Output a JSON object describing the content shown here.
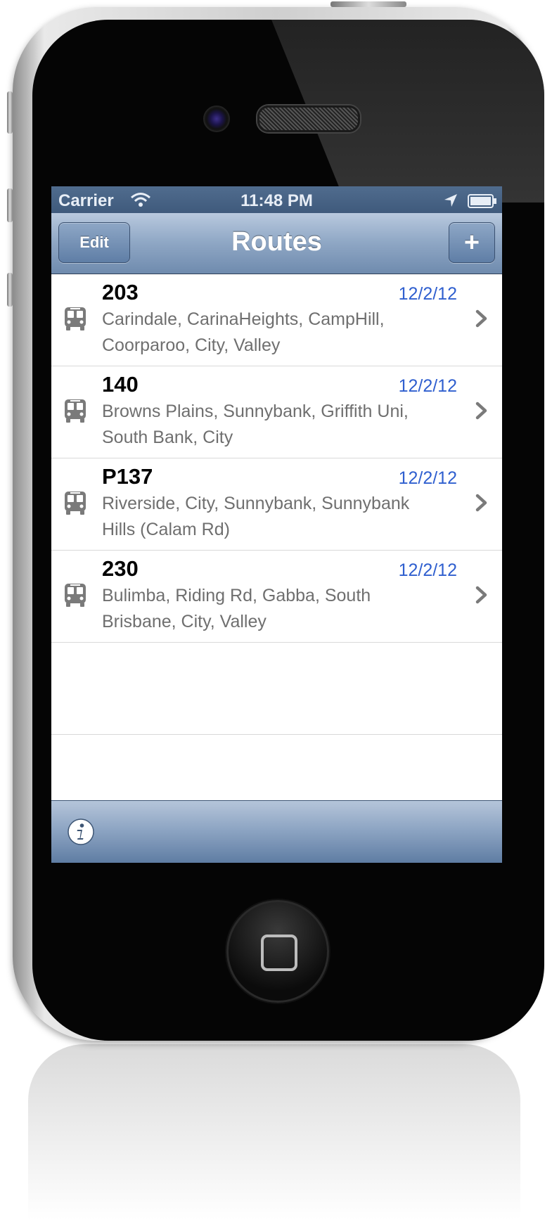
{
  "status_bar": {
    "carrier": "Carrier",
    "time": "11:48 PM"
  },
  "nav": {
    "title": "Routes",
    "edit_label": "Edit",
    "add_label": "+"
  },
  "routes": [
    {
      "number": "203",
      "date": "12/2/12",
      "stops": "Carindale, CarinaHeights, CampHill, Coorparoo, City, Valley"
    },
    {
      "number": "140",
      "date": "12/2/12",
      "stops": "Browns Plains, Sunnybank, Griffith Uni, South Bank, City"
    },
    {
      "number": "P137",
      "date": "12/2/12",
      "stops": "Riverside, City, Sunnybank, Sunnybank Hills (Calam Rd)"
    },
    {
      "number": "230",
      "date": "12/2/12",
      "stops": "Bulimba, Riding Rd, Gabba, South Brisbane, City, Valley"
    }
  ],
  "colors": {
    "nav_bar": "#8ea6c4",
    "date_text": "#2f5fcf",
    "stops_text": "#6f6f6f"
  },
  "icons": {
    "row_icon": "bus-icon",
    "row_accessory": "chevron-right-icon",
    "toolbar": "info-icon"
  }
}
